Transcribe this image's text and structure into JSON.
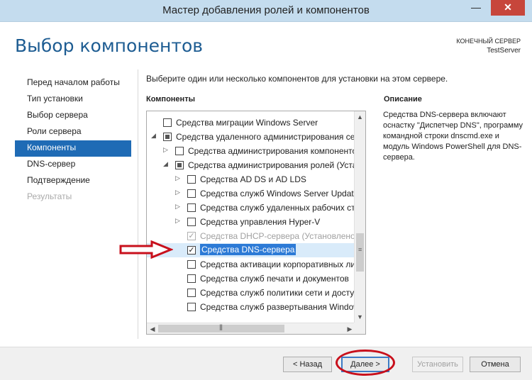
{
  "window": {
    "title": "Мастер добавления ролей и компонентов",
    "minimize_glyph": "—",
    "close_glyph": "✕"
  },
  "page": {
    "title": "Выбор компонентов",
    "destination_label": "КОНЕЧНЫЙ СЕРВЕР",
    "destination_server": "TestServer"
  },
  "nav": {
    "items": [
      {
        "label": "Перед началом работы",
        "state": "normal"
      },
      {
        "label": "Тип установки",
        "state": "normal"
      },
      {
        "label": "Выбор сервера",
        "state": "normal"
      },
      {
        "label": "Роли сервера",
        "state": "normal"
      },
      {
        "label": "Компоненты",
        "state": "active"
      },
      {
        "label": "DNS-сервер",
        "state": "normal"
      },
      {
        "label": "Подтверждение",
        "state": "normal"
      },
      {
        "label": "Результаты",
        "state": "disabled"
      }
    ]
  },
  "main": {
    "instruction": "Выберите один или несколько компонентов для установки на этом сервере.",
    "components_heading": "Компоненты",
    "description_heading": "Описание",
    "description_text": "Средства DNS-сервера включают оснастку \"Диспетчер DNS\", программу командной строки dnscmd.exe и модуль Windows PowerShell для DNS-сервера."
  },
  "tree": {
    "items": [
      {
        "label": "Средства миграции Windows Server",
        "level": 0,
        "expander": "none",
        "check": "unchecked",
        "selected": false,
        "dim": false
      },
      {
        "label": "Средства удаленного администрирования сервера",
        "level": 0,
        "expander": "expanded",
        "check": "partial",
        "selected": false,
        "dim": false
      },
      {
        "label": "Средства администрирования компонентов",
        "level": 1,
        "expander": "collapsed",
        "check": "unchecked",
        "selected": false,
        "dim": false
      },
      {
        "label": "Средства администрирования ролей (Установлено)",
        "level": 1,
        "expander": "expanded",
        "check": "partial",
        "selected": false,
        "dim": false
      },
      {
        "label": "Средства AD DS и AD LDS",
        "level": 2,
        "expander": "collapsed",
        "check": "unchecked",
        "selected": false,
        "dim": false
      },
      {
        "label": "Средства служб Windows Server Update Services",
        "level": 2,
        "expander": "collapsed",
        "check": "unchecked",
        "selected": false,
        "dim": false
      },
      {
        "label": "Средства служб удаленных рабочих столов",
        "level": 2,
        "expander": "collapsed",
        "check": "unchecked",
        "selected": false,
        "dim": false
      },
      {
        "label": "Средства управления Hyper-V",
        "level": 2,
        "expander": "collapsed",
        "check": "unchecked",
        "selected": false,
        "dim": false
      },
      {
        "label": "Средства DHCP-сервера (Установлено)",
        "level": 2,
        "expander": "none",
        "check": "checked-disabled",
        "selected": false,
        "dim": true
      },
      {
        "label": "Средства DNS-сервера",
        "level": 2,
        "expander": "none",
        "check": "checked",
        "selected": true,
        "dim": false
      },
      {
        "label": "Средства активации корпоративных лицензий",
        "level": 2,
        "expander": "none",
        "check": "unchecked",
        "selected": false,
        "dim": false
      },
      {
        "label": "Средства служб печати и документов",
        "level": 2,
        "expander": "none",
        "check": "unchecked",
        "selected": false,
        "dim": false
      },
      {
        "label": "Средства служб политики сети и доступа",
        "level": 2,
        "expander": "none",
        "check": "unchecked",
        "selected": false,
        "dim": false
      },
      {
        "label": "Средства служб развертывания Windows",
        "level": 2,
        "expander": "none",
        "check": "unchecked",
        "selected": false,
        "dim": false
      }
    ],
    "scroll_up_glyph": "▲",
    "scroll_down_glyph": "▼",
    "scroll_left_glyph": "◀",
    "scroll_right_glyph": "▶"
  },
  "footer": {
    "back_label": "< Назад",
    "next_label": "Далее >",
    "install_label": "Установить",
    "cancel_label": "Отмена"
  },
  "annotations": {
    "arrow_color": "#c8101c",
    "ring_color": "#c8101c"
  }
}
